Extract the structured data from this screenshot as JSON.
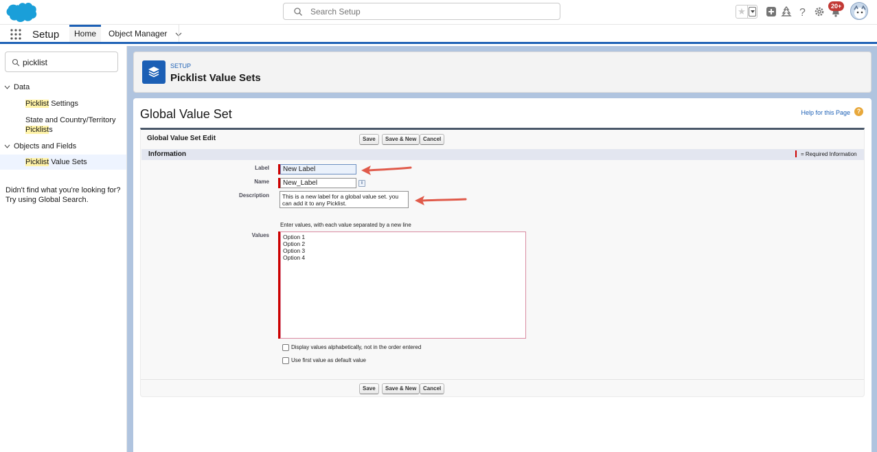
{
  "header": {
    "search_placeholder": "Search Setup",
    "notification_count": "20+"
  },
  "context_bar": {
    "app_name": "Setup",
    "tabs": [
      {
        "label": "Home",
        "active": true
      },
      {
        "label": "Object Manager",
        "active": false
      }
    ]
  },
  "sidebar": {
    "search_value": "picklist",
    "groups": [
      {
        "label": "Data",
        "expanded": true
      },
      {
        "label": "Objects and Fields",
        "expanded": true
      }
    ],
    "items": {
      "picklist_settings": {
        "hl": "Picklist",
        "rest": " Settings"
      },
      "state_country": {
        "line1": "State and Country/Territory",
        "hl": "Picklist",
        "rest": "s"
      },
      "picklist_value_sets": {
        "hl": "Picklist",
        "rest": " Value Sets"
      }
    },
    "help_text": "Didn't find what you're looking for? Try using Global Search."
  },
  "page_header": {
    "eyebrow": "SETUP",
    "title": "Picklist Value Sets"
  },
  "content": {
    "page_title": "Global Value Set",
    "help_link": "Help for this Page",
    "block_title": "Global Value Set Edit",
    "buttons": {
      "save": "Save",
      "save_new": "Save & New",
      "cancel": "Cancel"
    },
    "section_title": "Information",
    "required_legend": "= Required Information",
    "fields": {
      "label_label": "Label",
      "label_value": "New Label",
      "name_label": "Name",
      "name_value": "New_Label",
      "description_label": "Description",
      "description_value": "This is a new label for a global value set. you can add it to any Picklist.",
      "values_hint": "Enter values, with each value separated by a new line",
      "values_label": "Values",
      "values_value": "Option 1\nOption 2\nOption 3\nOption 4"
    },
    "checkboxes": {
      "alphabetical": "Display values alphabetically, not in the order entered",
      "default_first": "Use first value as default value"
    }
  },
  "colors": {
    "brand": "#1b5fb5",
    "required": "#c00000",
    "annotation_arrow": "#e05a4a"
  }
}
